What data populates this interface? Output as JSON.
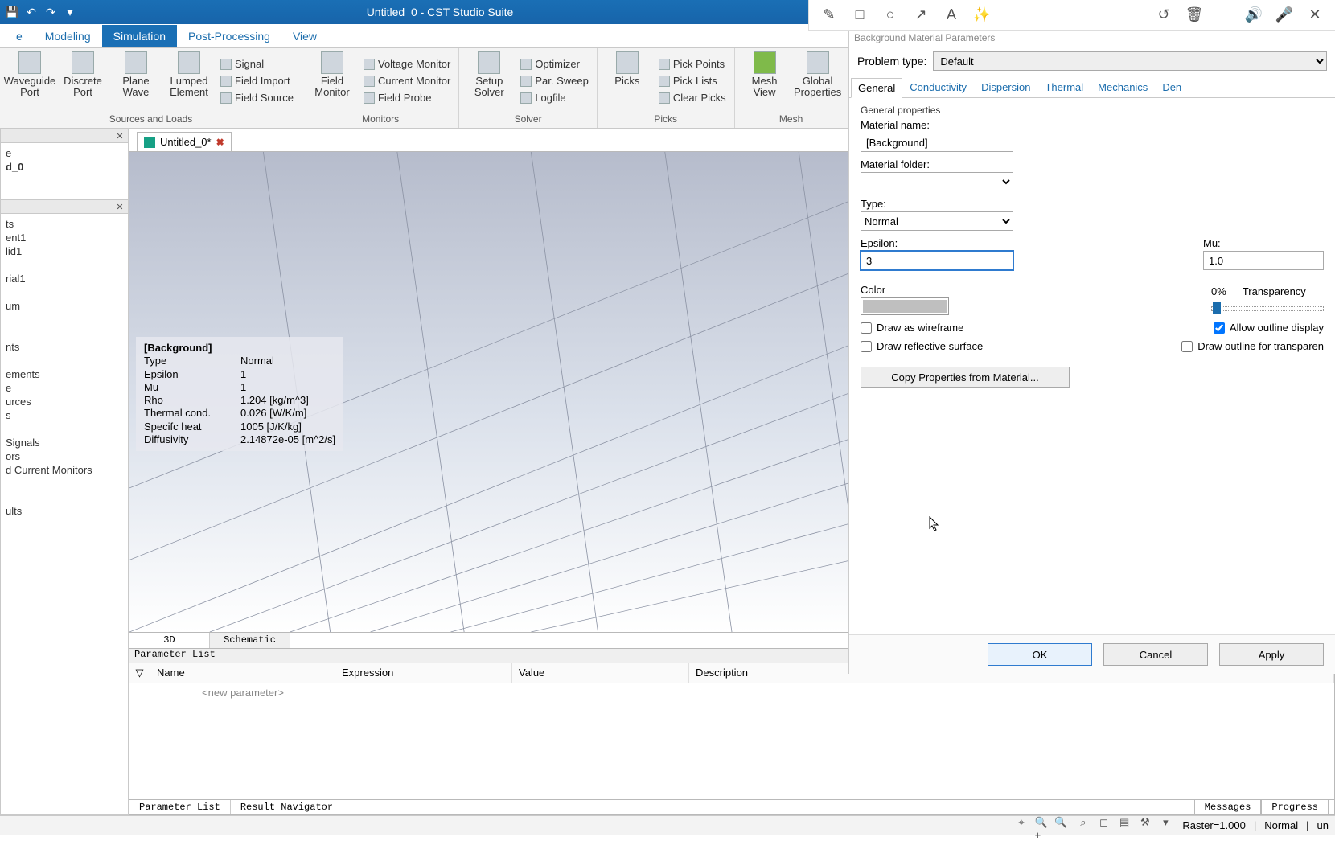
{
  "app": {
    "title": "Untitled_0 - CST Studio Suite"
  },
  "qat": [
    "save-icon",
    "undo-icon",
    "redo-icon",
    "dropdown-icon"
  ],
  "ribbon_tabs": {
    "items": [
      "e",
      "Modeling",
      "Simulation",
      "Post-Processing",
      "View"
    ],
    "active": 2
  },
  "ribbon_groups": {
    "sources": {
      "label": "Sources and Loads",
      "big": [
        {
          "l1": "Waveguide",
          "l2": "Port"
        },
        {
          "l1": "Discrete",
          "l2": "Port"
        },
        {
          "l1": "Plane",
          "l2": "Wave"
        },
        {
          "l1": "Lumped",
          "l2": "Element"
        }
      ],
      "small": [
        "Signal",
        "Field Import",
        "Field Source"
      ]
    },
    "monitors": {
      "label": "Monitors",
      "big": [
        {
          "l1": "Field",
          "l2": "Monitor"
        }
      ],
      "small": [
        "Voltage Monitor",
        "Current Monitor",
        "Field Probe"
      ]
    },
    "solver": {
      "label": "Solver",
      "big": [
        {
          "l1": "Setup",
          "l2": "Solver"
        }
      ],
      "small": [
        "Optimizer",
        "Par. Sweep",
        "Logfile"
      ]
    },
    "picks": {
      "label": "Picks",
      "big": [
        {
          "l1": "Picks",
          "l2": ""
        }
      ],
      "small": [
        "Pick Points",
        "Pick Lists",
        "Clear Picks"
      ]
    },
    "mesh": {
      "label": "Mesh",
      "big": [
        {
          "l1": "Mesh",
          "l2": "View"
        },
        {
          "l1": "Global",
          "l2": "Properties"
        }
      ]
    }
  },
  "left": {
    "panel1": {
      "items": [
        "d_0"
      ]
    },
    "panel2": {
      "items": [
        "ts",
        "ent1",
        "lid1",
        "",
        "rial1",
        "",
        "um",
        "",
        "",
        "nts",
        "",
        "ements",
        "e",
        "urces",
        "s",
        "",
        "Signals",
        "ors",
        "d Current Monitors",
        "",
        "",
        "ults"
      ]
    }
  },
  "doc_tab": {
    "name": "Untitled_0*"
  },
  "overlay": {
    "title": "[Background]",
    "rows": [
      [
        "Type",
        "Normal"
      ],
      [
        "Epsilon",
        "1"
      ],
      [
        "Mu",
        "1"
      ],
      [
        "Rho",
        "1.204 [kg/m^3]"
      ],
      [
        "Thermal cond.",
        "0.026 [W/K/m]"
      ],
      [
        "Specifc heat",
        "1005 [J/K/kg]"
      ],
      [
        "Diffusivity",
        "2.14872e-05 [m^2/s]"
      ]
    ]
  },
  "view_tabs": {
    "items": [
      "3D",
      "Schematic"
    ],
    "active": 0
  },
  "param_list": {
    "title": "Parameter List",
    "cols": [
      "Name",
      "Expression",
      "Value",
      "Description"
    ],
    "placeholder": "<new parameter>",
    "bottom_tabs": [
      "Parameter List",
      "Result Navigator"
    ]
  },
  "props": {
    "dlg_title": "Background Material Parameters",
    "problem_type": {
      "label": "Problem type:",
      "value": "Default"
    },
    "tabs": {
      "items": [
        "General",
        "Conductivity",
        "Dispersion",
        "Thermal",
        "Mechanics",
        "Den"
      ],
      "active": 0
    },
    "general": {
      "group": "General properties",
      "material_name": {
        "label": "Material name:",
        "value": "[Background]"
      },
      "material_folder": {
        "label": "Material folder:",
        "value": ""
      },
      "type": {
        "label": "Type:",
        "value": "Normal"
      },
      "epsilon": {
        "label": "Epsilon:",
        "value": "3"
      },
      "mu": {
        "label": "Mu:",
        "value": "1.0"
      },
      "color": {
        "label": "Color",
        "hex": "#bfbfbf"
      },
      "transparency": {
        "label": "Transparency",
        "pct": "0%"
      },
      "chk_wireframe": {
        "label": "Draw as wireframe",
        "checked": false
      },
      "chk_outline": {
        "label": "Allow outline display",
        "checked": true
      },
      "chk_reflective": {
        "label": "Draw reflective surface",
        "checked": false
      },
      "chk_outline_transp": {
        "label": "Draw outline for transparen",
        "checked": false
      },
      "copy_btn": "Copy Properties from Material..."
    },
    "buttons": {
      "ok": "OK",
      "cancel": "Cancel",
      "apply": "Apply"
    }
  },
  "msg_tabs": [
    "Messages",
    "Progress"
  ],
  "status": {
    "raster_label": "Raster=",
    "raster_value": "1.000",
    "mode": "Normal",
    "unit": "un"
  },
  "annot": [
    "pencil-icon",
    "square-icon",
    "circle-icon",
    "arrow-icon",
    "text-icon",
    "wand-icon",
    "",
    "undo-icon",
    "trash-icon",
    "",
    "speaker-icon",
    "mic-icon",
    "close-icon"
  ]
}
